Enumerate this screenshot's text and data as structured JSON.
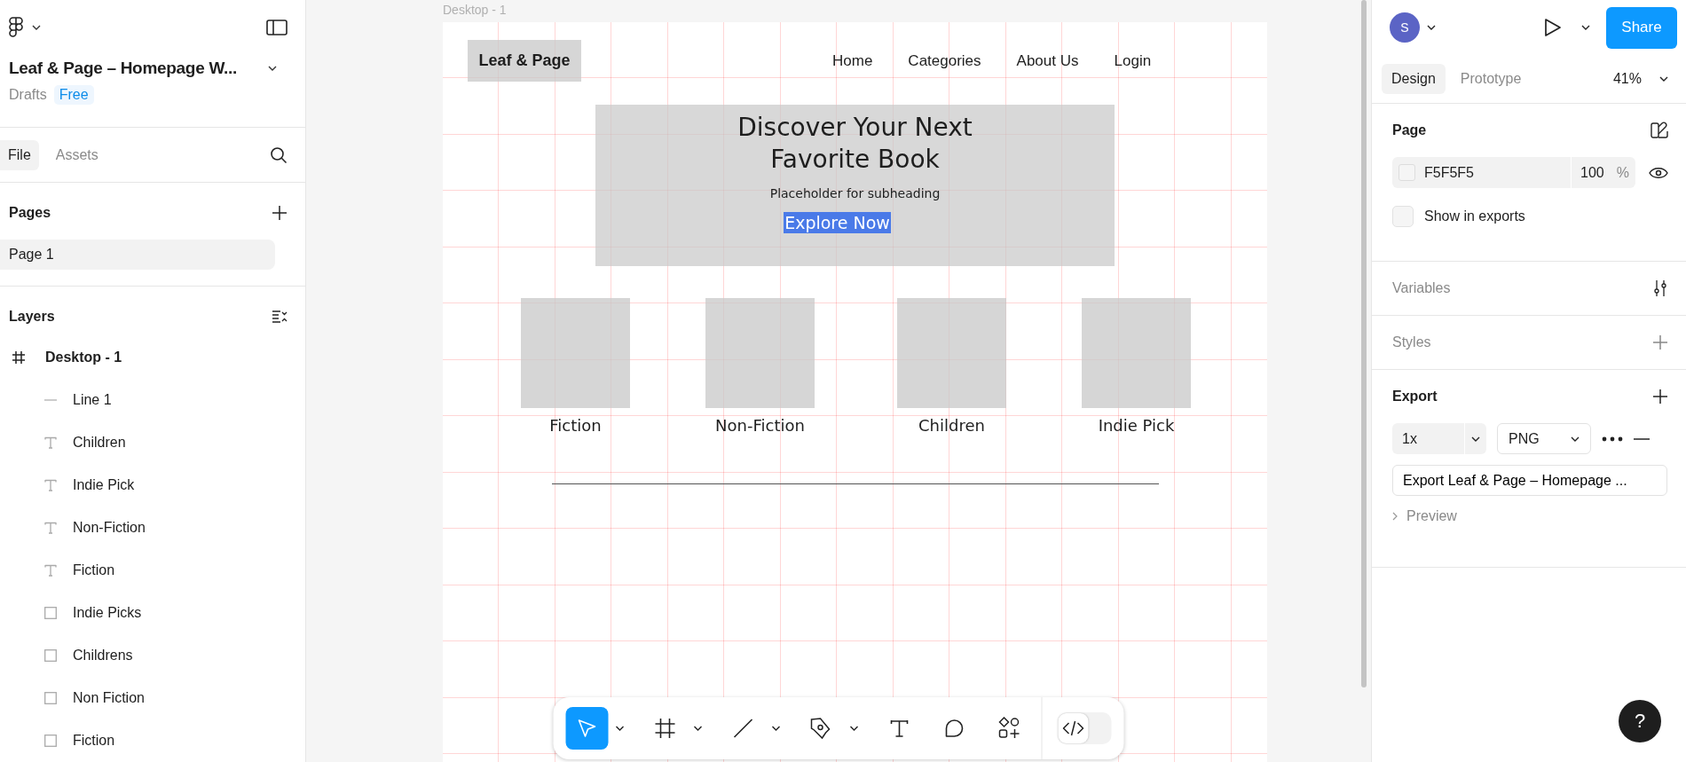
{
  "file": {
    "title": "Leaf & Page – Homepage W...",
    "location": "Drafts",
    "plan": "Free"
  },
  "left_tabs": [
    {
      "label": "File",
      "selected": true
    },
    {
      "label": "Assets",
      "selected": false
    }
  ],
  "pages": {
    "heading": "Pages",
    "items": [
      {
        "label": "Page 1",
        "selected": true
      }
    ]
  },
  "layers": {
    "heading": "Layers",
    "items": [
      {
        "label": "Desktop - 1",
        "kind": "frame",
        "children": [
          {
            "label": "Line 1",
            "kind": "line"
          },
          {
            "label": "Children",
            "kind": "text"
          },
          {
            "label": "Indie Pick",
            "kind": "text"
          },
          {
            "label": "Non-Fiction",
            "kind": "text"
          },
          {
            "label": "Fiction",
            "kind": "text"
          },
          {
            "label": "Indie Picks",
            "kind": "rect"
          },
          {
            "label": "Childrens",
            "kind": "rect"
          },
          {
            "label": "Non Fiction",
            "kind": "rect"
          },
          {
            "label": "Fiction",
            "kind": "rect"
          }
        ]
      }
    ]
  },
  "canvas": {
    "frame_label": "Desktop - 1",
    "logo": "Leaf & Page",
    "nav": [
      "Home",
      "Categories",
      "About Us",
      "Login"
    ],
    "hero_title_lines": [
      "Discover Your Next",
      "Favorite Book"
    ],
    "subheading": "Placeholder for subheading",
    "cta": "Explore Now",
    "categories": [
      "Fiction",
      "Non-Fiction",
      "Children",
      "Indie Pick"
    ]
  },
  "toolbar": {
    "tools": [
      {
        "kind": "move",
        "selected": true,
        "menu": true
      },
      {
        "kind": "frame",
        "selected": false,
        "menu": true
      },
      {
        "kind": "line",
        "selected": false,
        "menu": true
      },
      {
        "kind": "pen",
        "selected": false,
        "menu": true
      },
      {
        "kind": "text",
        "selected": false,
        "menu": false
      },
      {
        "kind": "comment",
        "selected": false,
        "menu": false
      },
      {
        "kind": "actions",
        "selected": false,
        "menu": false
      }
    ],
    "dev_mode": {
      "on": false
    }
  },
  "right_panel": {
    "avatar": "S",
    "share": "Share",
    "tabs": [
      {
        "label": "Design",
        "selected": true
      },
      {
        "label": "Prototype",
        "selected": false
      }
    ],
    "zoom": "41%",
    "page": {
      "heading": "Page",
      "color_value": "F5F5F5",
      "opacity": "100",
      "opacity_unit": "%",
      "show_in_exports": {
        "label": "Show in exports",
        "checked": false
      }
    },
    "variables": "Variables",
    "styles": "Styles",
    "export": {
      "heading": "Export",
      "scale": "1x",
      "format": "PNG",
      "button": "Export Leaf & Page – Homepage ...",
      "preview": "Preview"
    }
  },
  "help": "?"
}
